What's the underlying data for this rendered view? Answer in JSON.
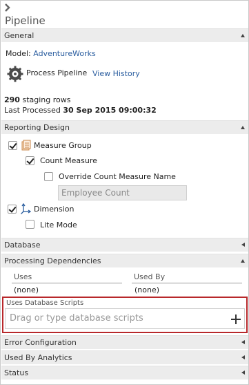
{
  "header": {
    "title": "Pipeline",
    "collapse_icon": "chevron-right-icon"
  },
  "general": {
    "title": "General",
    "model_label": "Model:",
    "model_value": "AdventureWorks",
    "process_label": "Process Pipeline",
    "view_history": "View History",
    "staging_count": "290",
    "staging_label": "staging rows",
    "last_processed_label": "Last Processed",
    "last_processed_value": "30 Sep 2015 09:00:32"
  },
  "reporting": {
    "title": "Reporting Design",
    "measure_group": {
      "label": "Measure Group",
      "checked": true
    },
    "count_measure": {
      "label": "Count Measure",
      "checked": true
    },
    "override_name": {
      "label": "Override Count Measure Name",
      "checked": false
    },
    "count_name_input": {
      "value": "Employee Count"
    },
    "dimension": {
      "label": "Dimension",
      "checked": true
    },
    "lite_mode": {
      "label": "Lite Mode",
      "checked": false
    }
  },
  "database": {
    "title": "Database"
  },
  "dependencies": {
    "title": "Processing Dependencies",
    "uses_label": "Uses",
    "used_by_label": "Used By",
    "uses_value": "(none)",
    "used_by_value": "(none)"
  },
  "scripts": {
    "label": "Uses Database Scripts",
    "placeholder": "Drag or type database scripts"
  },
  "collapsed_sections": {
    "error": "Error Configuration",
    "analytics": "Used By Analytics",
    "status": "Status"
  },
  "colors": {
    "highlight": "#b8282b",
    "link": "#2a5d9f",
    "header_bg": "#ececec"
  }
}
